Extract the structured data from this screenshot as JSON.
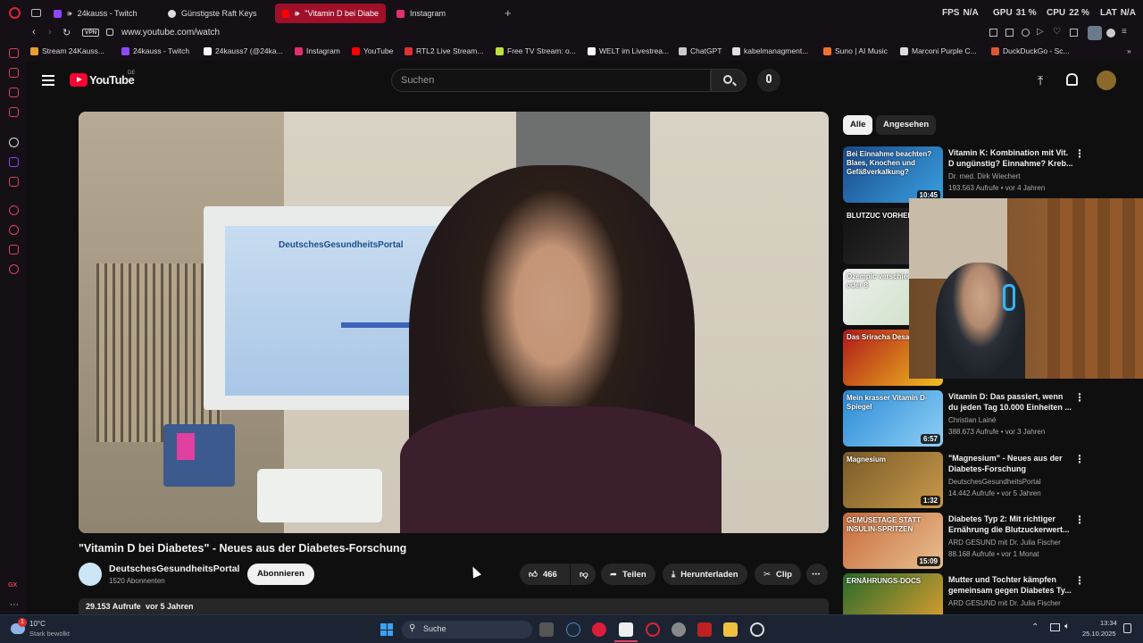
{
  "browser": {
    "tabs": [
      {
        "label": "24kauss - Twitch"
      },
      {
        "label": "Günstigste Raft Keys"
      },
      {
        "label": "\"Vitamin D bei Diabe"
      },
      {
        "label": "Instagram"
      }
    ],
    "stats": {
      "fps_label": "FPS",
      "fps_value": "N/A",
      "gpu_label": "GPU",
      "gpu_value": "31 %",
      "cpu_label": "CPU",
      "cpu_value": "22 %",
      "lat_label": "LAT",
      "lat_value": "N/A"
    },
    "vpn_label": "VPN",
    "url": "www.youtube.com/watch",
    "bookmarks": [
      {
        "label": "Stream 24Kauss...",
        "color": "#e8a030"
      },
      {
        "label": "24kauss - Twitch",
        "color": "#9146ff"
      },
      {
        "label": "24kauss7 (@24ka...",
        "color": "#ffffff"
      },
      {
        "label": "Instagram",
        "color": "#e1306c"
      },
      {
        "label": "YouTube",
        "color": "#ff0000"
      },
      {
        "label": "RTL2 Live Stream...",
        "color": "#e03030"
      },
      {
        "label": "Free TV Stream: o...",
        "color": "#c0e040"
      },
      {
        "label": "WELT im Livestrea...",
        "color": "#ffffff"
      },
      {
        "label": "ChatGPT",
        "color": "#cccccc"
      },
      {
        "label": "kabelmanagment...",
        "color": "#e0e0e0"
      },
      {
        "label": "Suno | AI Music",
        "color": "#f07030"
      },
      {
        "label": "Marconi Purple C...",
        "color": "#dddddd"
      },
      {
        "label": "DuckDuckGo - Sc...",
        "color": "#de5833"
      }
    ]
  },
  "youtube": {
    "logo_text": "YouTube",
    "region": "DE",
    "search_placeholder": "Suchen",
    "chips": [
      "Alle",
      "Angesehen"
    ],
    "video": {
      "title": "\"Vitamin D bei Diabetes\" - Neues aus der Diabetes-Forschung",
      "channel": "DeutschesGesundheitsPortal",
      "subscribers": "1520 Abonnenten",
      "subscribe_label": "Abonnieren",
      "likes": "466",
      "share_label": "Teilen",
      "download_label": "Herunterladen",
      "clip_label": "Clip",
      "views": "29.153 Aufrufe",
      "age": "vor 5 Jahren",
      "screen_text": "DeutschesGesundheitsPortal"
    },
    "related": [
      {
        "title": "Vitamin K: Kombination mit Vit. D ungünstig? Einnahme? Kreb...",
        "channel": "Dr. med. Dirk Wiechert",
        "meta": "193.563 Aufrufe • vor 4 Jahren",
        "duration": "10:45",
        "thumb_text": "Bei Einnahme beachten? Blaes, Knochen und Gefäßverkalkung?"
      },
      {
        "title": "",
        "channel": "",
        "meta": "",
        "duration": "",
        "thumb_text": "BLUTZUC VORHER 350"
      },
      {
        "title": "",
        "channel": "",
        "meta": "",
        "duration": "",
        "thumb_text": "Ozempic verschieden 4 oder 8"
      },
      {
        "title": "",
        "channel": "",
        "meta": "",
        "duration": "",
        "thumb_text": "Das Sriracha Desaster"
      },
      {
        "title": "Vitamin D: Das passiert, wenn du jeden Tag 10.000 Einheiten ...",
        "channel": "Christian Lainé",
        "meta": "388.673 Aufrufe • vor 3 Jahren",
        "duration": "6:57",
        "thumb_text": "Mein krasser Vitamin D-Spiegel"
      },
      {
        "title": "\"Magnesium\" - Neues aus der Diabetes-Forschung",
        "channel": "DeutschesGesundheitsPortal",
        "meta": "14.442 Aufrufe • vor 5 Jahren",
        "duration": "1:32",
        "thumb_text": "Magnesium"
      },
      {
        "title": "Diabetes Typ 2: Mit richtiger Ernährung die Blutzuckerwert...",
        "channel": "ARD GESUND mit Dr. Julia Fischer",
        "meta": "88.168 Aufrufe • vor 1 Monat",
        "duration": "15:09",
        "thumb_text": "GEMÜSETAGE STATT INSULIN-SPRITZEN"
      },
      {
        "title": "Mutter und Tochter kämpfen gemeinsam gegen Diabetes Ty...",
        "channel": "ARD GESUND mit Dr. Julia Fischer",
        "meta": "",
        "duration": "",
        "thumb_text": "ERNÄHRUNGS-DOCS"
      }
    ]
  },
  "taskbar": {
    "weather_temp": "10°C",
    "weather_desc": "Stark bewölkt",
    "notification_count": "1",
    "search_label": "Suche",
    "time": "13:34",
    "date": "25.10.2025"
  },
  "colors": {
    "accent_red": "#ff0033",
    "browser_red": "#a0102a",
    "yt_bg": "#0f0f0f"
  }
}
